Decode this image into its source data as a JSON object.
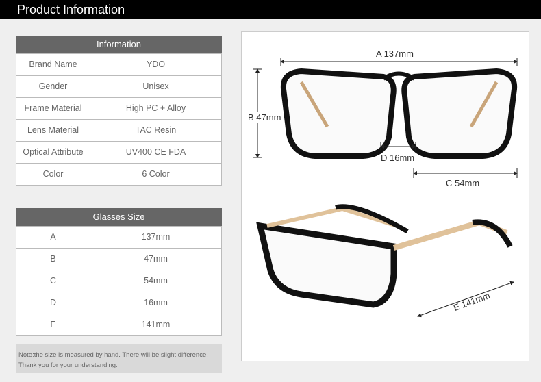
{
  "header": {
    "title": "Product Information"
  },
  "info": {
    "title": "Information",
    "rows": [
      {
        "key": "Brand Name",
        "value": "YDO"
      },
      {
        "key": "Gender",
        "value": "Unisex"
      },
      {
        "key": "Frame Material",
        "value": "High PC + Alloy"
      },
      {
        "key": "Lens Material",
        "value": "TAC Resin"
      },
      {
        "key": "Optical Attribute",
        "value": "UV400 CE FDA"
      },
      {
        "key": "Color",
        "value": "6 Color"
      }
    ]
  },
  "size": {
    "title": "Glasses Size",
    "rows": [
      {
        "key": "A",
        "value": "137mm"
      },
      {
        "key": "B",
        "value": "47mm"
      },
      {
        "key": "C",
        "value": "54mm"
      },
      {
        "key": "D",
        "value": "16mm"
      },
      {
        "key": "E",
        "value": "141mm"
      }
    ]
  },
  "note": {
    "line1": "Note:the size is measured by hand. There will be slight difference.",
    "line2": "Thank you for your understanding."
  },
  "diagram": {
    "a": "A 137mm",
    "b": "B 47mm",
    "c": "C 54mm",
    "d": "D 16mm",
    "e": "E 141mm"
  }
}
